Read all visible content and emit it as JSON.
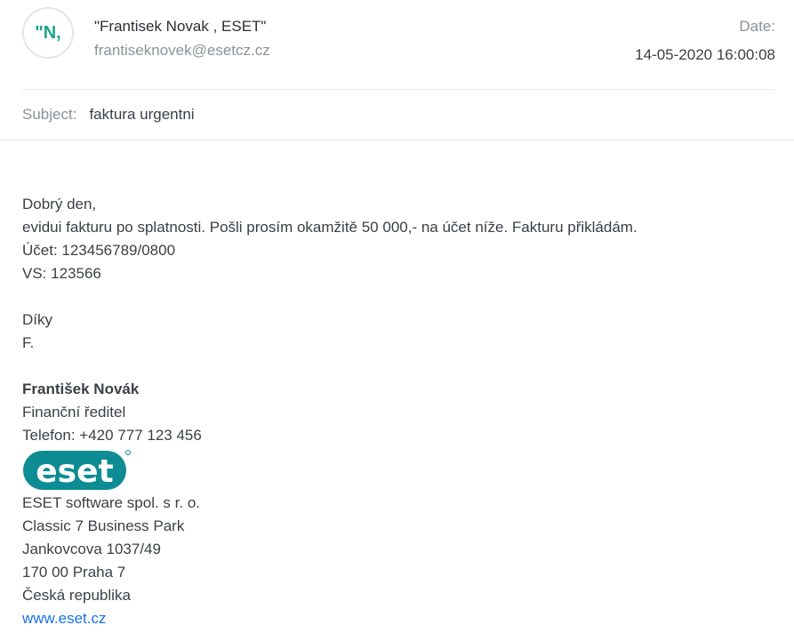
{
  "sender": {
    "avatar_initials": "\"N,",
    "name": "\"Frantisek Novak , ESET\"",
    "email": "frantiseknovek@esetcz.cz"
  },
  "date": {
    "label": "Date:",
    "value": "14-05-2020 16:00:08"
  },
  "subject": {
    "label": "Subject:",
    "value": "faktura urgentni"
  },
  "body": {
    "greeting": "Dobrý den,",
    "line1": "evidui fakturu po splatnosti. Pošli prosím okamžitě 50 000,- na účet níže. Fakturu přikládám.",
    "account": "Účet: 123456789/0800",
    "vs": "VS: 123566",
    "thanks": "Díky",
    "initial": "F."
  },
  "signature": {
    "name": "František Novák",
    "title": "Finanční ředitel",
    "phone": "Telefon: +420 777 123 456",
    "logo_text": "eset",
    "company": "ESET software spol. s r. o.",
    "address1": "Classic 7 Business Park",
    "address2": "Jankovcova 1037/49",
    "address3": "170 00 Praha 7",
    "country": "Česká republika",
    "website": "www.eset.cz"
  },
  "colors": {
    "accent": "#1aa58c",
    "eset_teal": "#0e8c93",
    "link": "#1a73e8"
  }
}
